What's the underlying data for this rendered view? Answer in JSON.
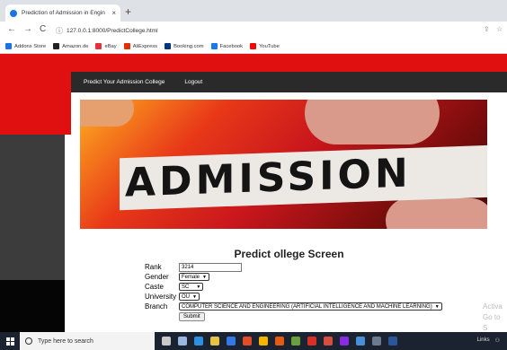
{
  "browser": {
    "tab_title": "Prediction of Admission in Engin",
    "tab_close": "×",
    "new_tab": "+",
    "back": "←",
    "forward": "→",
    "reload": "C",
    "url": "127.0.0.1:8000/PredictCollege.html",
    "bookmarks": [
      {
        "label": "Addons Store",
        "color": "#1a73e8"
      },
      {
        "label": "Amazon.de",
        "color": "#222222"
      },
      {
        "label": "eBay",
        "color": "#e53238"
      },
      {
        "label": "AliExpress",
        "color": "#e62e04"
      },
      {
        "label": "Booking.com",
        "color": "#003580"
      },
      {
        "label": "Facebook",
        "color": "#1877f2"
      },
      {
        "label": "YouTube",
        "color": "#ff0000"
      }
    ]
  },
  "nav": {
    "predict_label": "Predict Your Admission College",
    "logout_label": "Logout"
  },
  "banner": {
    "word": "ADMISSION"
  },
  "form": {
    "title": "Predict ollege Screen",
    "rank_label": "Rank",
    "rank_value": "3214",
    "gender_label": "Gender",
    "gender_value": "Female",
    "caste_label": "Caste",
    "caste_value": "SC",
    "university_label": "University",
    "university_value": "OU",
    "branch_label": "Branch",
    "branch_value": "COMPUTER SCIENCE AND ENGINEERING (ARTIFICIAL INTELLIGENCE AND MACHINE LEARNING)",
    "submit_label": "Submit"
  },
  "watermark": {
    "line1": "Activa",
    "line2": "Go to S"
  },
  "taskbar": {
    "search_placeholder": "Type here to search",
    "tray_text": "Links"
  },
  "colors": {
    "red_band": "#e01010",
    "nav_bar": "#2a2a2a",
    "taskbar": "#1b2230"
  }
}
